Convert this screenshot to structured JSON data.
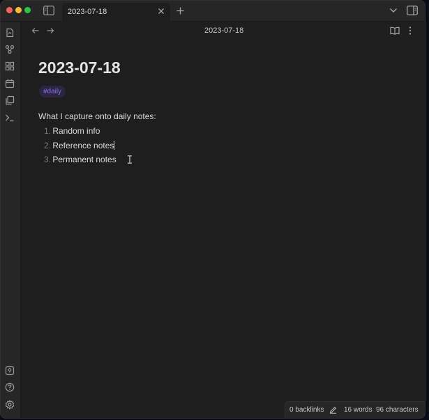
{
  "tab": {
    "title": "2023-07-18"
  },
  "view_header": {
    "title": "2023-07-18"
  },
  "note": {
    "title": "2023-07-18",
    "tag": "#daily",
    "paragraph": "What I capture onto daily notes:",
    "list": [
      {
        "num": "1.",
        "text": "Random info"
      },
      {
        "num": "2.",
        "text": "Reference notes"
      },
      {
        "num": "3.",
        "text": "Permanent notes"
      }
    ]
  },
  "status_bar": {
    "backlinks": "0 backlinks",
    "words": "16 words",
    "characters": "96 characters"
  },
  "colors": {
    "accent_tag": "#8b70e8",
    "background": "#1e1e1e",
    "chrome": "#262626"
  },
  "icons": {
    "ribbon": [
      "open-switcher-icon",
      "graph-view-icon",
      "canvas-icon",
      "daily-note-icon",
      "templates-icon",
      "command-palette-icon"
    ],
    "ribbon_bottom": [
      "vault-switch-icon",
      "help-icon",
      "settings-icon"
    ]
  }
}
